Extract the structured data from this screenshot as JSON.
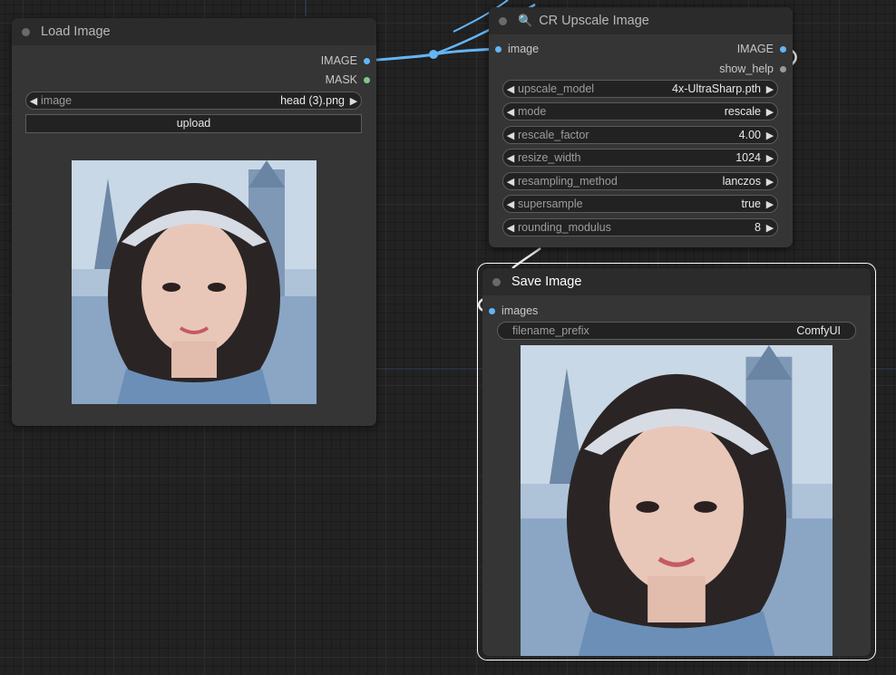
{
  "nodes": {
    "load_image": {
      "title": "Load Image",
      "outputs": [
        {
          "label": "IMAGE",
          "color": "#64b5f6"
        },
        {
          "label": "MASK",
          "color": "#81c784"
        }
      ],
      "image_widget": {
        "label": "image",
        "value": "head (3).png"
      },
      "upload_label": "upload"
    },
    "upscale": {
      "title": "CR Upscale Image",
      "title_icon": "magnifier-icon",
      "input_label": "image",
      "outputs": [
        {
          "label": "IMAGE",
          "color": "#64b5f6"
        },
        {
          "label": "show_help",
          "color": "#9a9a9a"
        }
      ],
      "widgets": [
        {
          "label": "upscale_model",
          "value": "4x-UltraSharp.pth"
        },
        {
          "label": "mode",
          "value": "rescale"
        },
        {
          "label": "rescale_factor",
          "value": "4.00"
        },
        {
          "label": "resize_width",
          "value": "1024"
        },
        {
          "label": "resampling_method",
          "value": "lanczos"
        },
        {
          "label": "supersample",
          "value": "true"
        },
        {
          "label": "rounding_modulus",
          "value": "8"
        }
      ]
    },
    "save_image": {
      "title": "Save Image",
      "input_label": "images",
      "widget": {
        "label": "filename_prefix",
        "value": "ComfyUI"
      }
    }
  },
  "colors": {
    "image_link": "#64b5f6",
    "selected_outline": "#ffffff"
  },
  "icons": {
    "widget_decrement": "◀",
    "widget_increment": "▶"
  }
}
